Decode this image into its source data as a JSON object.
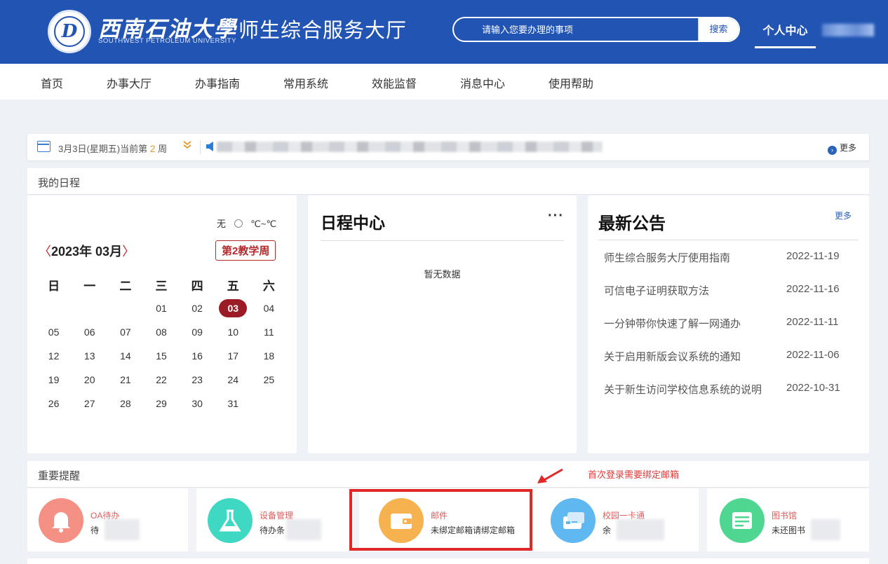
{
  "header": {
    "logo_letter": "D",
    "university_cn": "西南石油大學",
    "university_en": "SOUTHWEST PETROLEUM UNIVERSITY",
    "hall_title": "师生综合服务大厅",
    "search_placeholder": "请输入您要办理的事项",
    "search_button": "搜索",
    "personal_center": "个人中心",
    "brand_color": "#2254b4"
  },
  "nav": {
    "items": [
      "首页",
      "办事大厅",
      "办事指南",
      "常用系统",
      "效能监督",
      "消息中心",
      "使用帮助"
    ]
  },
  "datebar": {
    "date_prefix": "3月3日(星期五)当前第",
    "week_number": "2",
    "week_suffix": "周",
    "more": "更多"
  },
  "schedule": {
    "title": "我的日程",
    "weather_text": "无",
    "temp": "℃~℃",
    "month_label": "2023年 03月",
    "teaching_week": "第2教学周",
    "weekdays": [
      "日",
      "一",
      "二",
      "三",
      "四",
      "五",
      "六"
    ],
    "weeks": [
      [
        "",
        "",
        "",
        "01",
        "02",
        "03",
        "04"
      ],
      [
        "05",
        "06",
        "07",
        "08",
        "09",
        "10",
        "11"
      ],
      [
        "12",
        "13",
        "14",
        "15",
        "16",
        "17",
        "18"
      ],
      [
        "19",
        "20",
        "21",
        "22",
        "23",
        "24",
        "25"
      ],
      [
        "26",
        "27",
        "28",
        "29",
        "30",
        "31",
        ""
      ]
    ],
    "today": "03",
    "accent_color": "#9b1c24"
  },
  "schedule_center": {
    "title": "日程中心",
    "empty_text": "暂无数据"
  },
  "announcements": {
    "title": "最新公告",
    "more": "更多",
    "items": [
      {
        "title": "师生综合服务大厅使用指南",
        "date": "2022-11-19"
      },
      {
        "title": "可信电子证明获取方法",
        "date": "2022-11-16"
      },
      {
        "title": "一分钟带你快速了解一网通办",
        "date": "2022-11-11"
      },
      {
        "title": "关于启用新版会议系统的通知",
        "date": "2022-11-06"
      },
      {
        "title": "关于新生访问学校信息系统的说明",
        "date": "2022-10-31"
      }
    ]
  },
  "reminders": {
    "title": "重要提醒",
    "annotation": "首次登录需要绑定邮箱",
    "items": [
      {
        "name": "OA待办",
        "desc": "待",
        "icon": "bell-icon",
        "color": "#f49184"
      },
      {
        "name": "设备管理",
        "desc": "待办条",
        "icon": "flask-icon",
        "color": "#3fd8c2"
      },
      {
        "name": "邮件",
        "desc": "未绑定邮箱请绑定邮箱",
        "icon": "wallet-icon",
        "color": "#f5b24f"
      },
      {
        "name": "校园一卡通",
        "desc": "余",
        "icon": "card-icon",
        "color": "#5fb8f0"
      },
      {
        "name": "图书馆",
        "desc": "未还图书",
        "icon": "book-icon",
        "color": "#4fd690"
      }
    ]
  }
}
